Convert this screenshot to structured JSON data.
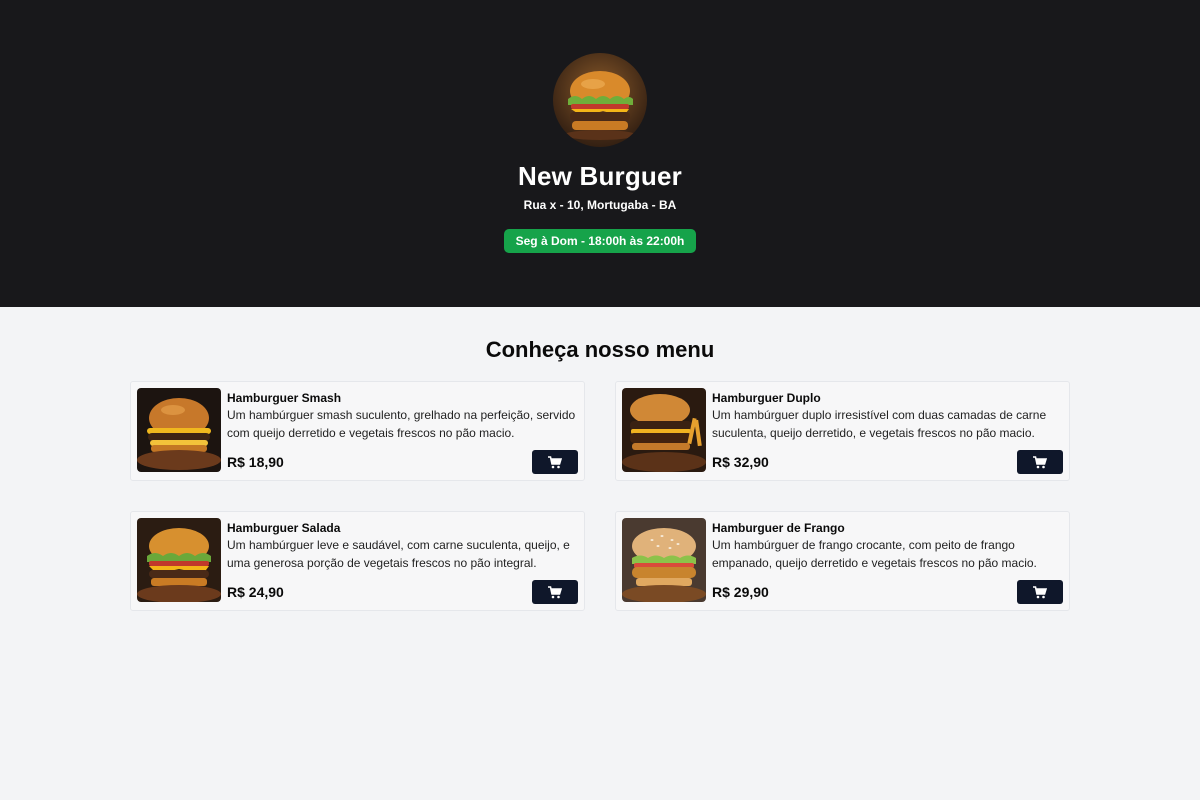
{
  "header": {
    "logo_icon": "burger-logo",
    "store_name": "New Burguer",
    "address": "Rua x - 10, Mortugaba - BA",
    "hours": "Seg à Dom - 18:00h às 22:00h",
    "hours_badge_color": "#16a34a"
  },
  "menu": {
    "title": "Conheça nosso menu",
    "cart_icon": "cart-icon",
    "items": [
      {
        "name": "Hamburguer Smash",
        "description": "Um hambúrguer smash suculento, grelhado na perfeição, servido com queijo derretido e vegetais frescos no pão macio.",
        "price": "R$ 18,90"
      },
      {
        "name": "Hamburguer Duplo",
        "description": "Um hambúrguer duplo irresistível com duas camadas de carne suculenta, queijo derretido, e vegetais frescos no pão macio.",
        "price": "R$ 32,90"
      },
      {
        "name": "Hamburguer Salada",
        "description": "Um hambúrguer leve e saudável, com carne suculenta, queijo, e uma generosa porção de vegetais frescos no pão integral.",
        "price": "R$ 24,90"
      },
      {
        "name": "Hamburguer de Frango",
        "description": "Um hambúrguer de frango crocante, com peito de frango empanado, queijo derretido e vegetais frescos no pão macio.",
        "price": "R$ 29,90"
      }
    ]
  },
  "colors": {
    "header_bg": "#18181b",
    "page_bg": "#f3f4f6",
    "cart_button": "#0f172a"
  }
}
